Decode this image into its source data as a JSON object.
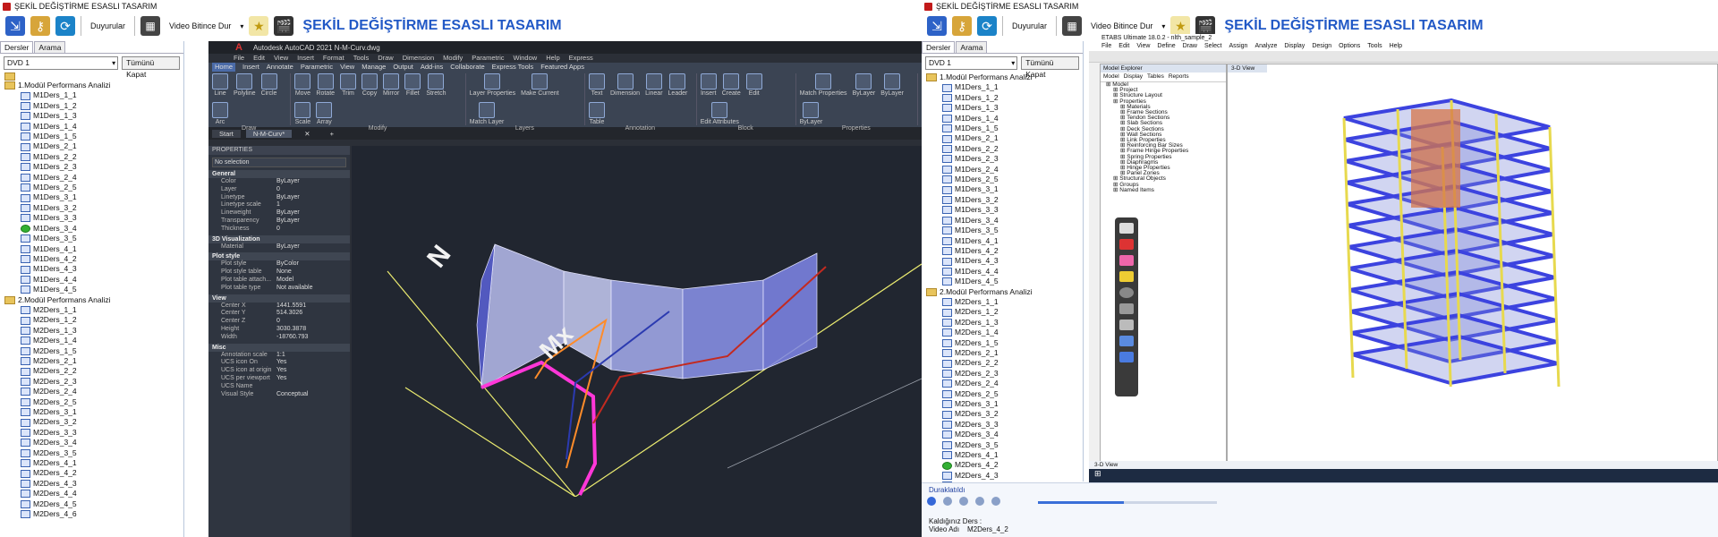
{
  "left": {
    "title": "ŞEKİL DEĞİŞTİRME ESASLI TASARIM",
    "toolbar": {
      "announcements_label": "Duyurular",
      "video_end_select": "Video Bitince Dur",
      "header_title": "ŞEKİL DEĞİŞTİRME ESASLI TASARIM"
    },
    "sidebar": {
      "tabs": [
        "Dersler",
        "Arama"
      ],
      "dvd_select": "DVD 1",
      "collapse_all": "Tümünü Kapat",
      "tree": [
        {
          "folder": "",
          "items": []
        },
        {
          "folder": "1.Modül Performans Analizi",
          "items": [
            "M1Ders_1_1",
            "M1Ders_1_2",
            "M1Ders_1_3",
            "M1Ders_1_4",
            "M1Ders_1_5",
            "M1Ders_2_1",
            "M1Ders_2_2",
            "M1Ders_2_3",
            "M1Ders_2_4",
            "M1Ders_2_5",
            "M1Ders_3_1",
            "M1Ders_3_2",
            "M1Ders_3_3",
            "M1Ders_3_4",
            "M1Ders_3_5",
            "M1Ders_4_1",
            "M1Ders_4_2",
            "M1Ders_4_3",
            "M1Ders_4_4",
            "M1Ders_4_5"
          ]
        },
        {
          "folder": "2.Modül Performans Analizi",
          "items": [
            "M2Ders_1_1",
            "M2Ders_1_2",
            "M2Ders_1_3",
            "M2Ders_1_4",
            "M2Ders_1_5",
            "M2Ders_2_1",
            "M2Ders_2_2",
            "M2Ders_2_3",
            "M2Ders_2_4",
            "M2Ders_2_5",
            "M2Ders_3_1",
            "M2Ders_3_2",
            "M2Ders_3_3",
            "M2Ders_3_4",
            "M2Ders_3_5",
            "M2Ders_4_1",
            "M2Ders_4_2",
            "M2Ders_4_3",
            "M2Ders_4_4",
            "M2Ders_4_5",
            "M2Ders_4_6"
          ]
        }
      ],
      "active_item": "M1Ders_3_4"
    },
    "autocad": {
      "window_title": "Autodesk AutoCAD 2021    N-M-Curv.dwg",
      "menu": [
        "File",
        "Edit",
        "View",
        "Insert",
        "Format",
        "Tools",
        "Draw",
        "Dimension",
        "Modify",
        "Parametric",
        "Window",
        "Help",
        "Express"
      ],
      "ribbon_tabs": [
        "Home",
        "Insert",
        "Annotate",
        "Parametric",
        "View",
        "Manage",
        "Output",
        "Add-ins",
        "Collaborate",
        "Express Tools",
        "Featured Apps"
      ],
      "ribbon_groups": [
        {
          "label": "Draw",
          "tools": [
            "Line",
            "Polyline",
            "Circle",
            "Arc"
          ]
        },
        {
          "label": "Modify",
          "tools": [
            "Move",
            "Rotate",
            "Trim",
            "Copy",
            "Mirror",
            "Fillet",
            "Stretch",
            "Scale",
            "Array"
          ]
        },
        {
          "label": "Layers",
          "tools": [
            "Layer Properties",
            "Make Current",
            "Match Layer"
          ]
        },
        {
          "label": "Annotation",
          "tools": [
            "Text",
            "Dimension",
            "Linear",
            "Leader",
            "Table"
          ]
        },
        {
          "label": "Block",
          "tools": [
            "Insert",
            "Create",
            "Edit",
            "Edit Attributes"
          ]
        },
        {
          "label": "Properties",
          "tools": [
            "Match Properties",
            "ByLayer",
            "ByLayer",
            "ByLayer"
          ]
        }
      ],
      "doc_tabs": [
        "Start",
        "N-M-Curv*"
      ],
      "properties": {
        "header": "PROPERTIES",
        "selection": "No selection",
        "sections": [
          {
            "name": "General",
            "rows": [
              [
                "Color",
                "ByLayer"
              ],
              [
                "Layer",
                "0"
              ],
              [
                "Linetype",
                "ByLayer"
              ],
              [
                "Linetype scale",
                "1"
              ],
              [
                "Lineweight",
                "ByLayer"
              ],
              [
                "Transparency",
                "ByLayer"
              ],
              [
                "Thickness",
                "0"
              ]
            ]
          },
          {
            "name": "3D Visualization",
            "rows": [
              [
                "Material",
                "ByLayer"
              ]
            ]
          },
          {
            "name": "Plot style",
            "rows": [
              [
                "Plot style",
                "ByColor"
              ],
              [
                "Plot style table",
                "None"
              ],
              [
                "Plot table attach...",
                "Model"
              ],
              [
                "Plot table type",
                "Not available"
              ]
            ]
          },
          {
            "name": "View",
            "rows": [
              [
                "Center X",
                "1441.5591"
              ],
              [
                "Center Y",
                "514.3026"
              ],
              [
                "Center Z",
                "0"
              ],
              [
                "Height",
                "3030.3878"
              ],
              [
                "Width",
                "-18760.793"
              ]
            ]
          },
          {
            "name": "Misc",
            "rows": [
              [
                "Annotation scale",
                "1:1"
              ],
              [
                "UCS icon On",
                "Yes"
              ],
              [
                "UCS icon at origin",
                "Yes"
              ],
              [
                "UCS per viewport",
                "Yes"
              ],
              [
                "UCS Name",
                ""
              ],
              [
                "Visual Style",
                "Conceptual"
              ]
            ]
          }
        ]
      },
      "canvas_labels": {
        "n": "N",
        "mx": "Mx"
      }
    }
  },
  "right": {
    "title": "ŞEKİL DEĞİŞTİRME ESASLI TASARIM",
    "toolbar": {
      "announcements_label": "Duyurular",
      "video_end_select": "Video Bitince Dur",
      "header_title": "ŞEKİL DEĞİŞTİRME ESASLI TASARIM"
    },
    "sidebar": {
      "tabs": [
        "Dersler",
        "Arama"
      ],
      "dvd_select": "DVD 1",
      "collapse_all": "Tümünü Kapat",
      "tree": [
        {
          "folder": "1.Modül Performans Analizi",
          "items": [
            "M1Ders_1_1",
            "M1Ders_1_2",
            "M1Ders_1_3",
            "M1Ders_1_4",
            "M1Ders_1_5",
            "M1Ders_2_1",
            "M1Ders_2_2",
            "M1Ders_2_3",
            "M1Ders_2_4",
            "M1Ders_2_5",
            "M1Ders_3_1",
            "M1Ders_3_2",
            "M1Ders_3_3",
            "M1Ders_3_4",
            "M1Ders_3_5",
            "M1Ders_4_1",
            "M1Ders_4_2",
            "M1Ders_4_3",
            "M1Ders_4_4",
            "M1Ders_4_5"
          ]
        },
        {
          "folder": "2.Modül Performans Analizi",
          "items": [
            "M2Ders_1_1",
            "M2Ders_1_2",
            "M2Ders_1_3",
            "M2Ders_1_4",
            "M2Ders_1_5",
            "M2Ders_2_1",
            "M2Ders_2_2",
            "M2Ders_2_3",
            "M2Ders_2_4",
            "M2Ders_2_5",
            "M2Ders_3_1",
            "M2Ders_3_2",
            "M2Ders_3_3",
            "M2Ders_3_4",
            "M2Ders_3_5",
            "M2Ders_4_1",
            "M2Ders_4_2",
            "M2Ders_4_3",
            "M2Ders_4_4",
            "M2Ders_4_5",
            "M2Ders_4_6"
          ]
        }
      ],
      "active_item": "M2Ders_4_2"
    },
    "etabs": {
      "window_title": "ETABS Ultimate 18.0.2 - nlth_sample_2",
      "menu": [
        "File",
        "Edit",
        "View",
        "Define",
        "Draw",
        "Select",
        "Assign",
        "Analyze",
        "Display",
        "Design",
        "Options",
        "Tools",
        "Help"
      ],
      "explorer": {
        "header": "Model Explorer",
        "tabs": [
          "Model",
          "Display",
          "Tables",
          "Reports"
        ],
        "nodes": [
          {
            "t": "Model",
            "lvl": 0
          },
          {
            "t": "Project",
            "lvl": 1
          },
          {
            "t": "Structure Layout",
            "lvl": 1
          },
          {
            "t": "Properties",
            "lvl": 1
          },
          {
            "t": "Materials",
            "lvl": 2
          },
          {
            "t": "Frame Sections",
            "lvl": 2
          },
          {
            "t": "Tendon Sections",
            "lvl": 2
          },
          {
            "t": "Slab Sections",
            "lvl": 2
          },
          {
            "t": "Deck Sections",
            "lvl": 2
          },
          {
            "t": "Wall Sections",
            "lvl": 2
          },
          {
            "t": "Link Properties",
            "lvl": 2
          },
          {
            "t": "Reinforcing Bar Sizes",
            "lvl": 2
          },
          {
            "t": "Frame Hinge Properties",
            "lvl": 2
          },
          {
            "t": "Spring Properties",
            "lvl": 2
          },
          {
            "t": "Diaphragms",
            "lvl": 2
          },
          {
            "t": "Hinge Properties",
            "lvl": 2
          },
          {
            "t": "Panel Zones",
            "lvl": 2
          },
          {
            "t": "Structural Objects",
            "lvl": 1
          },
          {
            "t": "Groups",
            "lvl": 1
          },
          {
            "t": "Named Items",
            "lvl": 1
          }
        ]
      },
      "view_tab": "3-D View",
      "status_left": "3-D View"
    },
    "player": {
      "status": "Duraklatıldı",
      "progress": 0.48,
      "last_lesson_label": "Kaldığınız Ders :",
      "video_name_label": "Video Adı",
      "video_name_value": "M2Ders_4_2"
    }
  },
  "colors": {
    "title_blue": "#2259c6",
    "beam_blue": "#3c43df",
    "column_yellow": "#e7d94e",
    "brick_orange": "#d5764a",
    "magenta": "#ff37d8",
    "line_orange": "#ff8c2a",
    "line_navy": "#2b3ab0",
    "line_red": "#c32a20"
  }
}
